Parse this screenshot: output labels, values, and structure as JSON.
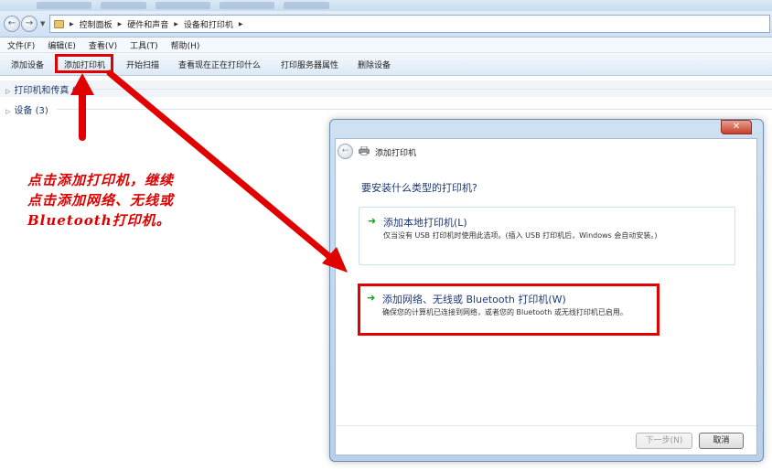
{
  "explorer": {
    "breadcrumb": [
      "控制面板",
      "硬件和声音",
      "设备和打印机"
    ],
    "menu": [
      "文件(F)",
      "编辑(E)",
      "查看(V)",
      "工具(T)",
      "帮助(H)"
    ],
    "toolbar": [
      "添加设备",
      "添加打印机",
      "开始扫描",
      "查看现在正在打印什么",
      "打印服务器属性",
      "删除设备"
    ],
    "groups": [
      {
        "label": "打印机和传真 (4)"
      },
      {
        "label": "设备 (3)"
      }
    ]
  },
  "annotation": {
    "lines": [
      "点击添加打印机，继续",
      "点击添加网络、无线或",
      "Bluetooth打印机。"
    ]
  },
  "dialog": {
    "title": "添加打印机",
    "close_glyph": "✕",
    "question": "要安装什么类型的打印机?",
    "options": [
      {
        "title": "添加本地打印机(L)",
        "desc": "仅当没有 USB 打印机时使用此选项。(插入 USB 打印机后，Windows 会自动安装。)"
      },
      {
        "title": "添加网络、无线或 Bluetooth 打印机(W)",
        "desc": "确保您的计算机已连接到网络，或者您的 Bluetooth 或无线打印机已启用。"
      }
    ],
    "next_label": "下一步(N)",
    "cancel_label": "取消"
  },
  "colors": {
    "annotation_red": "#e00000",
    "link_blue": "#1c3a78",
    "arrow_green": "#17a317"
  },
  "icons": {
    "back": "back-arrow-icon",
    "forward": "forward-arrow-icon",
    "option": "green-arrow-icon",
    "printer": "printer-icon"
  }
}
